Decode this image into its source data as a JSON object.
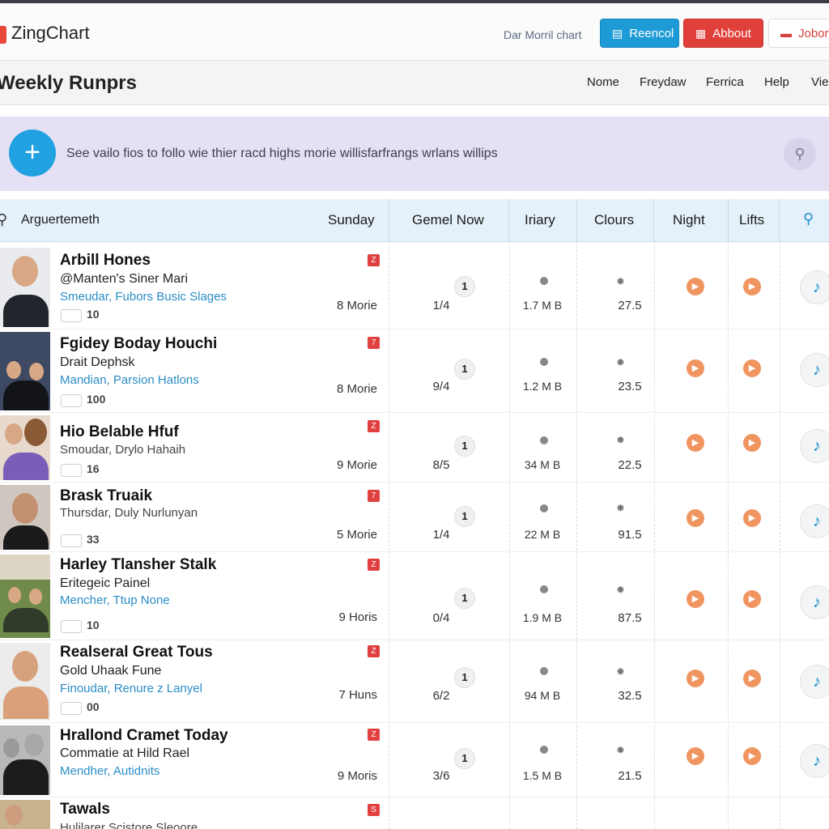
{
  "header": {
    "logo": "ZingChart",
    "link": "Dar Morril chart",
    "buttons": [
      {
        "label": "Reencol",
        "icon": "document-icon"
      },
      {
        "label": "Abbout",
        "icon": "calendar-icon"
      },
      {
        "label": "Jobor",
        "icon": "hat-icon"
      }
    ]
  },
  "titlebar": {
    "title": "Weekly Runprs",
    "nav": [
      "Nome",
      "Freydaw",
      "Ferrica",
      "Help",
      "Vie"
    ]
  },
  "banner": {
    "text": "See vailo fios to follo wie thier racd highs morie willisfarfrangs wrlans willips",
    "add_icon": "plus-icon",
    "tip_icon": "lightbulb-icon"
  },
  "table": {
    "search_label": "Arguertemeth",
    "columns": [
      "Sunday",
      "Gemel Now",
      "Iriary",
      "Clours",
      "Night",
      "Lifts"
    ],
    "rows": [
      {
        "title": "Arbill Hones",
        "subtitle": "@Manten's Siner Mari",
        "link": "Smeudar, Fubors Busic Slages",
        "count": "10",
        "badge": "Z",
        "sunday": "8 Morie",
        "num": "1",
        "frac": "1/4",
        "size": "1.7 M B",
        "clours": "27.5"
      },
      {
        "title": "Fgidey Boday Houchi",
        "subtitle": "Drait Dephsk",
        "link": "Mandian, Parsion Hatlons",
        "count": "100",
        "badge": "7",
        "sunday": "8 Morie",
        "num": "1",
        "frac": "9/4",
        "size": "1.2 M B",
        "clours": "23.5"
      },
      {
        "title": "Hio Belable Hfuf",
        "subtitle": "Smoudar, Drylo Hahaih",
        "link": "",
        "count": "16",
        "badge": "Z",
        "sunday": "9 Morie",
        "num": "1",
        "frac": "8/5",
        "size": "34 M B",
        "clours": "22.5"
      },
      {
        "title": "Brask Truaik",
        "subtitle": "Thursdar, Duly Nurlunyan",
        "link": "",
        "count": "33",
        "badge": "7",
        "sunday": "5 Morie",
        "num": "1",
        "frac": "1/4",
        "size": "22 M B",
        "clours": "91.5"
      },
      {
        "title": "Harley Tlansher Stalk",
        "subtitle": "Eritegeic Painel",
        "link": "Mencher, Ttup None",
        "count": "10",
        "badge": "Z",
        "sunday": "9 Horis",
        "num": "1",
        "frac": "0/4",
        "size": "1.9 M B",
        "clours": "87.5"
      },
      {
        "title": "Realseral Great Tous",
        "subtitle": "Gold Uhaak Fune",
        "link": "Finoudar, Renure z Lanyel",
        "count": "00",
        "badge": "Z",
        "sunday": "7 Huns",
        "num": "1",
        "frac": "6/2",
        "size": "94 M B",
        "clours": "32.5"
      },
      {
        "title": "Hrallond Cramet Today",
        "subtitle": "Commatie at Hild Rael",
        "link": "Mendher, Autidnits",
        "count": "",
        "badge": "Z",
        "sunday": "9 Moris",
        "num": "1",
        "frac": "3/6",
        "size": "1.5 M B",
        "clours": "21.5"
      },
      {
        "title": "Tawals",
        "subtitle": "Hulilarer Scistore Sleoore",
        "link": "",
        "count": "",
        "badge": "S",
        "sunday": "",
        "num": "",
        "frac": "",
        "size": "",
        "clours": ""
      }
    ]
  },
  "colors": {
    "accent": "#1e9bd6",
    "danger": "#e0403a",
    "banner": "#e6e0f5",
    "table_header": "#e5f1fa",
    "play": "#f09560"
  }
}
